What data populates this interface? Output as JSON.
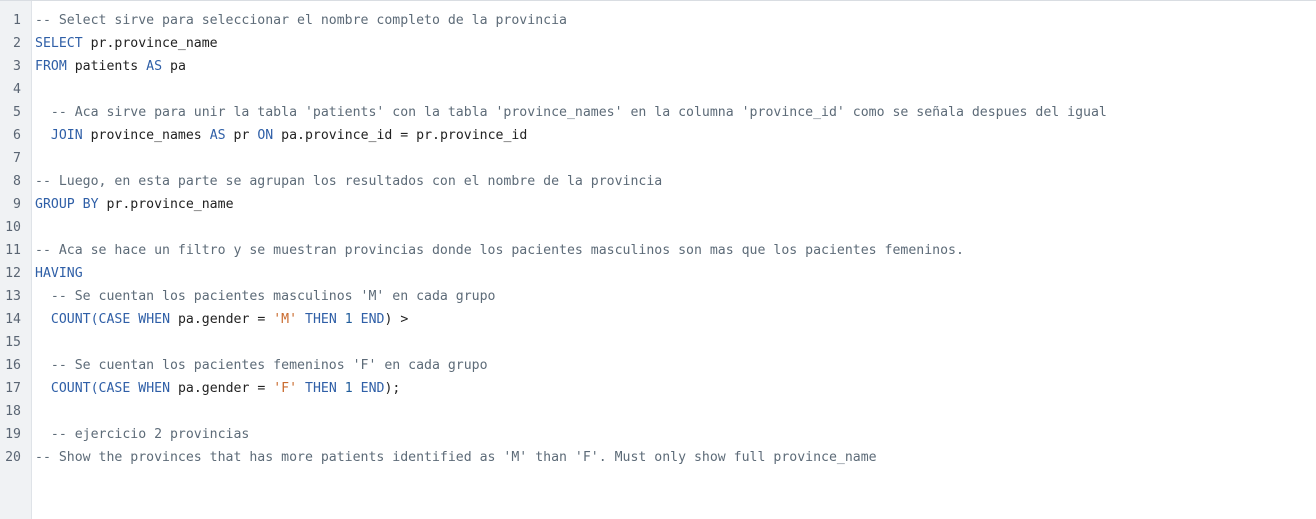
{
  "editor": {
    "lines": [
      {
        "number": "1",
        "tokens": [
          {
            "t": "-- Select sirve para seleccionar el nombre completo de la provincia",
            "c": "comment"
          }
        ]
      },
      {
        "number": "2",
        "tokens": [
          {
            "t": "SELECT",
            "c": "kw"
          },
          {
            "t": " pr.province_name",
            "c": "ident"
          }
        ]
      },
      {
        "number": "3",
        "tokens": [
          {
            "t": "FROM",
            "c": "kw"
          },
          {
            "t": " patients ",
            "c": "ident"
          },
          {
            "t": "AS",
            "c": "kw"
          },
          {
            "t": " pa",
            "c": "ident"
          }
        ]
      },
      {
        "number": "4",
        "tokens": []
      },
      {
        "number": "5",
        "tokens": [
          {
            "t": "  -- Aca sirve para unir la tabla 'patients' con la tabla 'province_names' en la columna 'province_id' como se señala despues del igual",
            "c": "comment"
          }
        ]
      },
      {
        "number": "6",
        "tokens": [
          {
            "t": "  JOIN",
            "c": "kw"
          },
          {
            "t": " province_names ",
            "c": "ident"
          },
          {
            "t": "AS",
            "c": "kw"
          },
          {
            "t": " pr ",
            "c": "ident"
          },
          {
            "t": "ON",
            "c": "kw"
          },
          {
            "t": " pa.province_id = pr.province_id",
            "c": "ident"
          }
        ]
      },
      {
        "number": "7",
        "tokens": []
      },
      {
        "number": "8",
        "tokens": [
          {
            "t": "-- Luego, en esta parte se agrupan los resultados con el nombre de la provincia",
            "c": "comment"
          }
        ]
      },
      {
        "number": "9",
        "tokens": [
          {
            "t": "GROUP BY",
            "c": "kw"
          },
          {
            "t": " pr.province_name",
            "c": "ident"
          }
        ]
      },
      {
        "number": "10",
        "tokens": []
      },
      {
        "number": "11",
        "tokens": [
          {
            "t": "-- Aca se hace un filtro y se muestran provincias donde los pacientes masculinos son mas que los pacientes femeninos.",
            "c": "comment"
          }
        ]
      },
      {
        "number": "12",
        "tokens": [
          {
            "t": "HAVING",
            "c": "kw"
          }
        ]
      },
      {
        "number": "13",
        "tokens": [
          {
            "t": "  -- Se cuentan los pacientes masculinos 'M' en cada grupo",
            "c": "comment"
          }
        ]
      },
      {
        "number": "14",
        "tokens": [
          {
            "t": "  COUNT(",
            "c": "kw"
          },
          {
            "t": "CASE",
            "c": "kw"
          },
          {
            "t": " ",
            "c": "ident"
          },
          {
            "t": "WHEN",
            "c": "kw"
          },
          {
            "t": " pa.gender = ",
            "c": "ident"
          },
          {
            "t": "'M'",
            "c": "str"
          },
          {
            "t": " ",
            "c": "ident"
          },
          {
            "t": "THEN",
            "c": "kw"
          },
          {
            "t": " ",
            "c": "ident"
          },
          {
            "t": "1",
            "c": "num"
          },
          {
            "t": " ",
            "c": "ident"
          },
          {
            "t": "END",
            "c": "kw"
          },
          {
            "t": ") >",
            "c": "ident"
          }
        ]
      },
      {
        "number": "15",
        "tokens": []
      },
      {
        "number": "16",
        "tokens": [
          {
            "t": "  -- Se cuentan los pacientes femeninos 'F' en cada grupo",
            "c": "comment"
          }
        ]
      },
      {
        "number": "17",
        "tokens": [
          {
            "t": "  COUNT(",
            "c": "kw"
          },
          {
            "t": "CASE",
            "c": "kw"
          },
          {
            "t": " ",
            "c": "ident"
          },
          {
            "t": "WHEN",
            "c": "kw"
          },
          {
            "t": " pa.gender = ",
            "c": "ident"
          },
          {
            "t": "'F'",
            "c": "str"
          },
          {
            "t": " ",
            "c": "ident"
          },
          {
            "t": "THEN",
            "c": "kw"
          },
          {
            "t": " ",
            "c": "ident"
          },
          {
            "t": "1",
            "c": "num"
          },
          {
            "t": " ",
            "c": "ident"
          },
          {
            "t": "END",
            "c": "kw"
          },
          {
            "t": ");",
            "c": "ident"
          }
        ]
      },
      {
        "number": "18",
        "tokens": []
      },
      {
        "number": "19",
        "tokens": [
          {
            "t": "  -- ejercicio 2 provincias",
            "c": "comment"
          }
        ]
      },
      {
        "number": "20",
        "tokens": [
          {
            "t": "-- Show the provinces that has more patients identified as 'M' than 'F'. Must only show full province_name",
            "c": "comment"
          }
        ]
      }
    ]
  }
}
